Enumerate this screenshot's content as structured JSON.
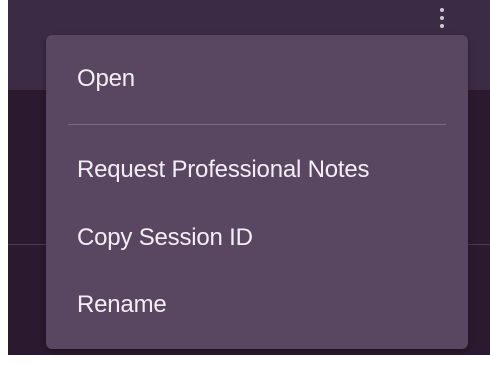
{
  "header": {
    "more_icon": "vertical-ellipsis-icon"
  },
  "context_menu": {
    "items": [
      {
        "label": "Open"
      },
      {
        "label": "Request Professional Notes"
      },
      {
        "label": "Copy Session ID"
      },
      {
        "label": "Rename"
      }
    ]
  },
  "colors": {
    "menu_background": "#594660",
    "app_background": "#2b1a2f",
    "header_background": "#3b2b45",
    "menu_text": "#f3eef5"
  }
}
